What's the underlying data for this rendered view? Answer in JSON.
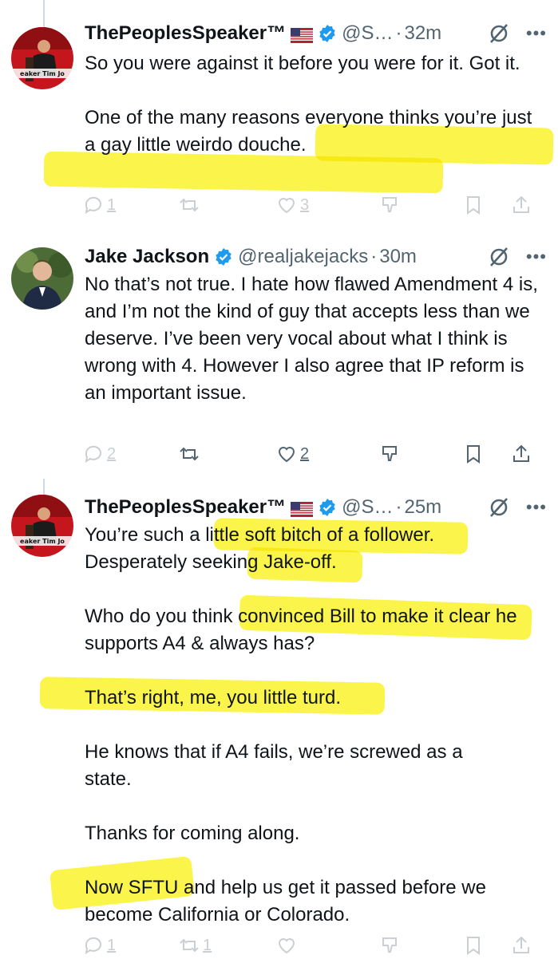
{
  "tweets": [
    {
      "name": "ThePeoplesSpeaker™",
      "handle": "@S…",
      "dot": "·",
      "time": "32m",
      "avatar_text": "eaker Tim Jo",
      "paragraphs": [
        "So you were against it before you were for it. Got it.",
        "One of the many reasons everyone thinks you’re just a gay little weirdo douche."
      ],
      "replies": "1",
      "retweets": "",
      "likes": "3"
    },
    {
      "name": "Jake Jackson",
      "handle": "@realjakejacks",
      "dot": "·",
      "time": "30m",
      "paragraphs": [
        "No that’s not true. I hate how flawed Amendment 4 is, and I’m not the kind of guy that accepts less than we deserve. I’ve been very vocal about what I think is wrong with 4. However I also agree that IP reform is an important issue."
      ],
      "replies": "2",
      "retweets": "",
      "likes": "2"
    },
    {
      "name": "ThePeoplesSpeaker™",
      "handle": "@S…",
      "dot": "·",
      "time": "25m",
      "avatar_text": "eaker Tim Jo",
      "paragraphs": [
        "You’re such a little soft bitch of a follower. Desperately seeking Jake-off.",
        "Who do you think convinced Bill to make it clear he supports A4 & always has?",
        "That’s right, me, you little turd.",
        "He knows that if A4 fails, we’re screwed as a state.",
        "Thanks for coming along.",
        "Now SFTU and help us get it passed before we become California or Colorado."
      ],
      "replies": "1",
      "retweets": "1",
      "likes": ""
    }
  ],
  "icons": [
    "reply-icon",
    "retweet-icon",
    "like-icon",
    "downvote-icon",
    "bookmark-icon",
    "share-icon",
    "grok-icon",
    "more-icon",
    "verified-badge-icon",
    "us-flag-icon"
  ],
  "colors": {
    "text": "#0f1419",
    "muted": "#536471",
    "verified": "#1d9bf0",
    "highlight": "#fbf32b",
    "thread_line": "#cfd9de"
  }
}
